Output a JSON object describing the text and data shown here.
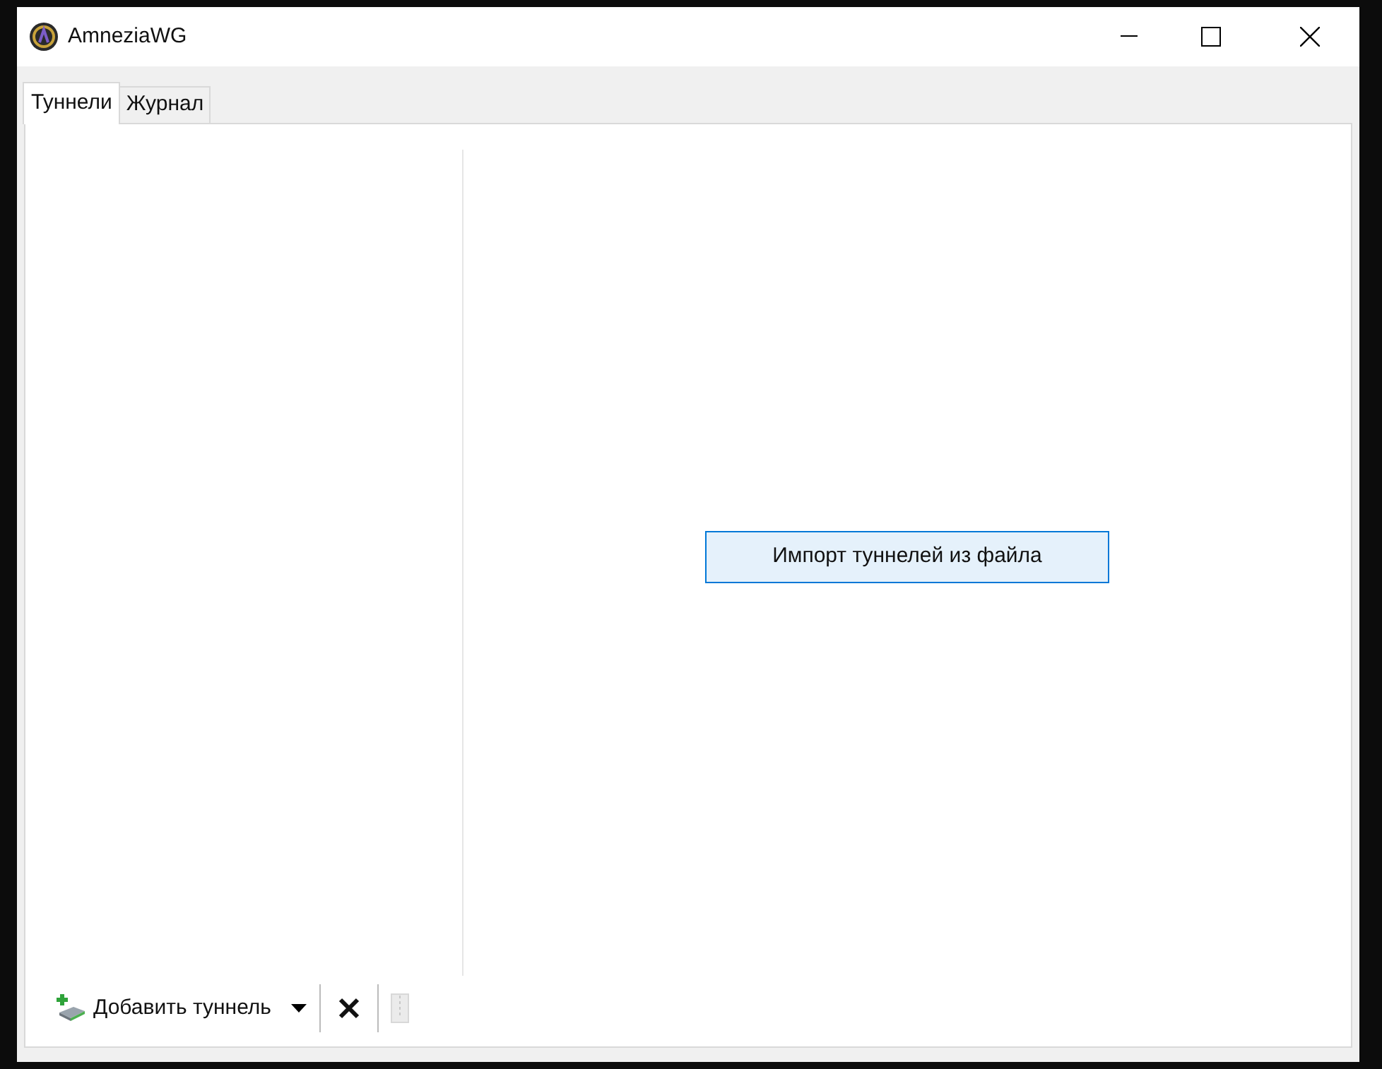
{
  "window": {
    "title": "AmneziaWG"
  },
  "tabs": [
    {
      "label": "Туннели",
      "selected": true
    },
    {
      "label": "Журнал",
      "selected": false
    }
  ],
  "main": {
    "import_button": "Импорт туннелей из файла"
  },
  "toolbar": {
    "add_button": "Добавить туннель",
    "export_disabled": true
  }
}
